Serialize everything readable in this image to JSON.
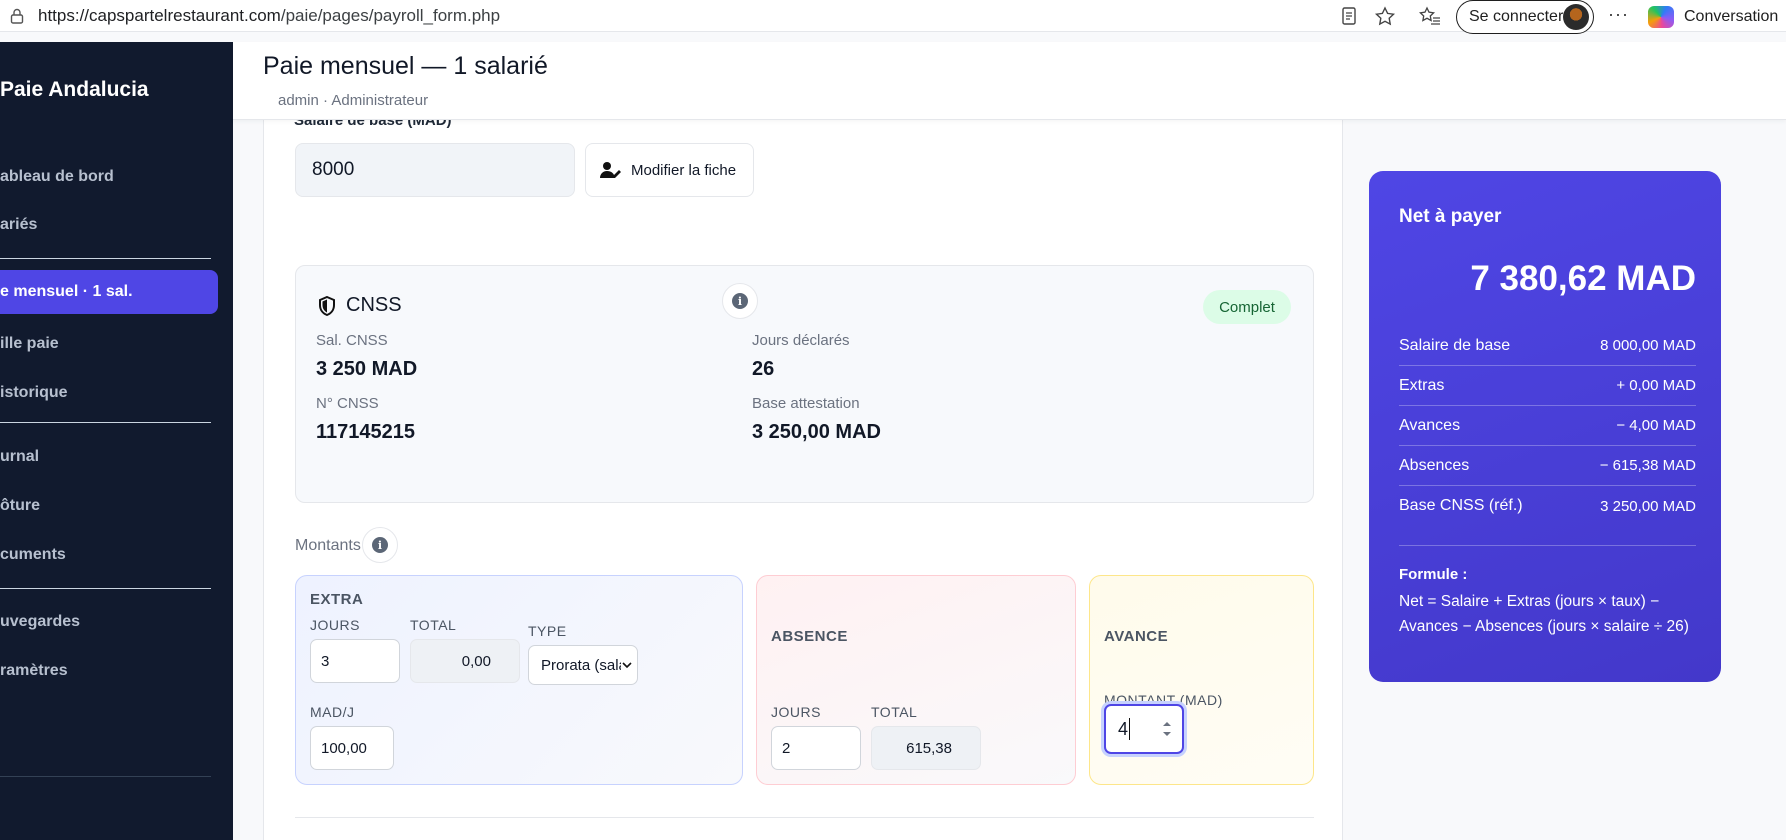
{
  "browser": {
    "url_host": "https://capspartelrestaurant.com",
    "url_path": "/paie/pages/payroll_form.php",
    "login_label": "Se connecter",
    "more_label": "···",
    "conversation_label": "Conversation"
  },
  "sidebar": {
    "brand": "Paie Andalucia",
    "items": [
      {
        "label": "ableau de bord"
      },
      {
        "label": "ariés"
      },
      {
        "label": "e mensuel · 1 sal."
      },
      {
        "label": "ille paie"
      },
      {
        "label": "istorique"
      },
      {
        "label": "urnal"
      },
      {
        "label": "ôture"
      },
      {
        "label": "cuments"
      },
      {
        "label": "uvegardes"
      },
      {
        "label": "ramètres"
      }
    ]
  },
  "header": {
    "title": "Paie mensuel — 1 salarié",
    "user": "admin · Administrateur"
  },
  "form": {
    "salaire_label": "Salaire de base (MAD)",
    "salaire_value": "8000",
    "modify_label": "Modifier la fiche",
    "info_glyph": "i",
    "cnss": {
      "title": "CNSS",
      "status": "Complet",
      "sal_cnss_label": "Sal. CNSS",
      "sal_cnss_value": "3 250 MAD",
      "jours_label": "Jours déclarés",
      "jours_value": "26",
      "numero_label": "N° CNSS",
      "numero_value": "117145215",
      "base_label": "Base attestation",
      "base_value": "3 250,00 MAD"
    },
    "montants_label": "Montants",
    "extra": {
      "title": "EXTRA",
      "jours_label": "JOURS",
      "jours_value": "3",
      "total_label": "TOTAL",
      "total_value": "0,00",
      "type_label": "TYPE",
      "type_value": "Prorata (salai",
      "madj_label": "MAD/J",
      "madj_value": "100,00"
    },
    "absence": {
      "title": "ABSENCE",
      "jours_label": "JOURS",
      "jours_value": "2",
      "total_label": "TOTAL",
      "total_value": "615,38"
    },
    "avance": {
      "title": "AVANCE",
      "montant_label": "MONTANT (MAD)",
      "montant_value": "4"
    }
  },
  "net": {
    "title": "Net à payer",
    "amount": "7 380,62 MAD",
    "rows": [
      {
        "label": "Salaire de base",
        "value": "8 000,00 MAD"
      },
      {
        "label": "Extras",
        "value": "+ 0,00 MAD"
      },
      {
        "label": "Avances",
        "value": "− 4,00 MAD"
      },
      {
        "label": "Absences",
        "value": "− 615,38 MAD"
      },
      {
        "label": "Base CNSS (réf.)",
        "value": "3 250,00 MAD"
      }
    ],
    "formula_title": "Formule :",
    "formula_text": "Net = Salaire + Extras (jours × taux) − Avances − Absences (jours × salaire ÷ 26)"
  },
  "colors": {
    "accent": "#4f46e5",
    "sidebar_bg": "#111a2e",
    "status_green_bg": "#dcfce7"
  },
  "icons": [
    "lock-icon",
    "reader-icon",
    "star-icon",
    "favorites-icon",
    "copilot-icon",
    "user-edit-icon",
    "info-icon",
    "shield-icon",
    "chevron-down-icon",
    "stepper-icon"
  ]
}
